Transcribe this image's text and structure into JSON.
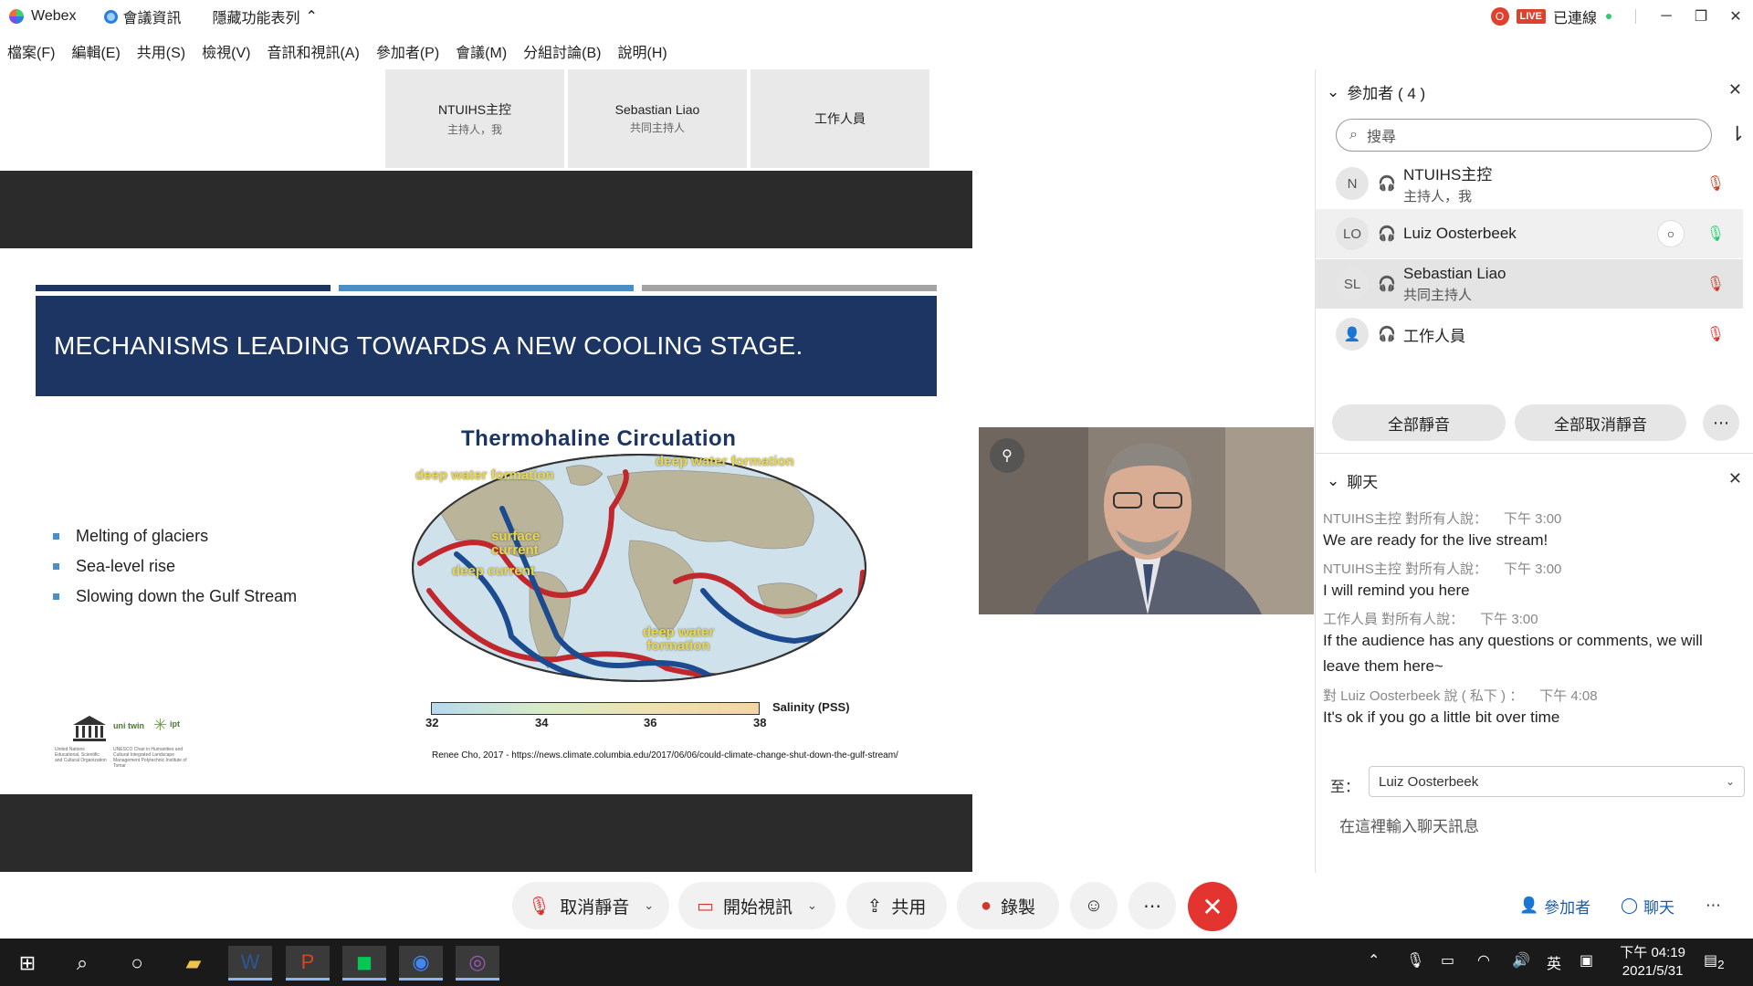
{
  "titlebar": {
    "app_name": "Webex",
    "meeting_info": "會議資訊",
    "hide_menu": "隱藏功能表列",
    "rec_badge": "O",
    "live": "LIVE",
    "status": "已連線",
    "minimize": "─",
    "restore": "❐",
    "close": "✕"
  },
  "menu": [
    "檔案(F)",
    "編輯(E)",
    "共用(S)",
    "檢視(V)",
    "音訊和視訊(A)",
    "參加者(P)",
    "會議(M)",
    "分組討論(B)",
    "說明(H)"
  ],
  "thumbnails": [
    {
      "name": "NTUIHS主控",
      "role": "主持人，我"
    },
    {
      "name": "Sebastian Liao",
      "role": "共同主持人"
    },
    {
      "name": "工作人員",
      "role": ""
    }
  ],
  "slide": {
    "title": "MECHANISMS LEADING TOWARDS A NEW COOLING STAGE.",
    "bullets": [
      "Melting of glaciers",
      "Sea-level rise",
      "Slowing down the Gulf Stream"
    ],
    "map_title": "Thermohaline Circulation",
    "map_labels": {
      "dwf_left": "deep water formation",
      "dwf_right": "deep water formation",
      "surface": "surface current",
      "deep": "deep current",
      "dwf_bottom": "deep water formation"
    },
    "scale_ticks": [
      "32",
      "34",
      "36",
      "38"
    ],
    "scale_label": "Salinity (PSS)",
    "citation": "Renee Cho, 2017 - https://news.climate.columbia.edu/2017/06/06/could-climate-change-shut-down-the-gulf-stream/",
    "logo_texts": {
      "unesco": "United Nations Educational, Scientific and Cultural Organization",
      "chair": "UNESCO Chair in Humanities and Cultural Integrated Landscape Management Polytechnic Institute of Tomar",
      "unitwin": "uni twin",
      "ipt": "ipt"
    }
  },
  "video": {
    "pin_icon": "⚲"
  },
  "participants_panel": {
    "title": "參加者 ( 4 )",
    "search_placeholder": "搜尋",
    "list": [
      {
        "initials": "N",
        "name": "NTUIHS主控",
        "role": "主持人，我",
        "mic": "muted"
      },
      {
        "initials": "LO",
        "name": "Luiz Oosterbeek",
        "role": "",
        "mic": "active"
      },
      {
        "initials": "SL",
        "name": "Sebastian Liao",
        "role": "共同主持人",
        "mic": "muted"
      },
      {
        "initials": "",
        "name": "工作人員",
        "role": "",
        "mic": "muted-locked"
      }
    ],
    "mute_all": "全部靜音",
    "unmute_all": "全部取消靜音",
    "more": "⋯"
  },
  "chat": {
    "title": "聊天",
    "messages": [
      {
        "meta": "NTUIHS主控 對所有人說：",
        "time": "下午 3:00",
        "text": "We are ready for the live stream!"
      },
      {
        "meta": "NTUIHS主控 對所有人說：",
        "time": "下午 3:00",
        "text": "I will remind you here"
      },
      {
        "meta": "工作人員 對所有人說：",
        "time": "下午 3:00",
        "text": "If the audience has any questions or comments, we will leave them here~"
      },
      {
        "meta": "對 Luiz Oosterbeek 說 ( 私下 ) ：",
        "time": "下午 4:08",
        "text": "It's ok if you go a little bit over time"
      }
    ],
    "to_label": "至：",
    "to_value": "Luiz Oosterbeek",
    "input_placeholder": "在這裡輸入聊天訊息"
  },
  "controls": {
    "unmute": "取消靜音",
    "start_video": "開始視訊",
    "share": "共用",
    "record": "錄製",
    "emoji": "☺",
    "more": "⋯",
    "end": "✕",
    "participants": "參加者",
    "chat": "聊天",
    "panel_more": "⋯"
  },
  "taskbar": {
    "ime": "英",
    "time": "下午 04:19",
    "date": "2021/5/31",
    "notif_count": "2"
  },
  "colors": {
    "slide_title_bg": "#1c3563",
    "bar_dark": "#1c3563",
    "bar_mid": "#4a8fc6",
    "bar_light": "#a3a3a3",
    "end_call": "#e3342f",
    "accent": "#1a5cab"
  }
}
